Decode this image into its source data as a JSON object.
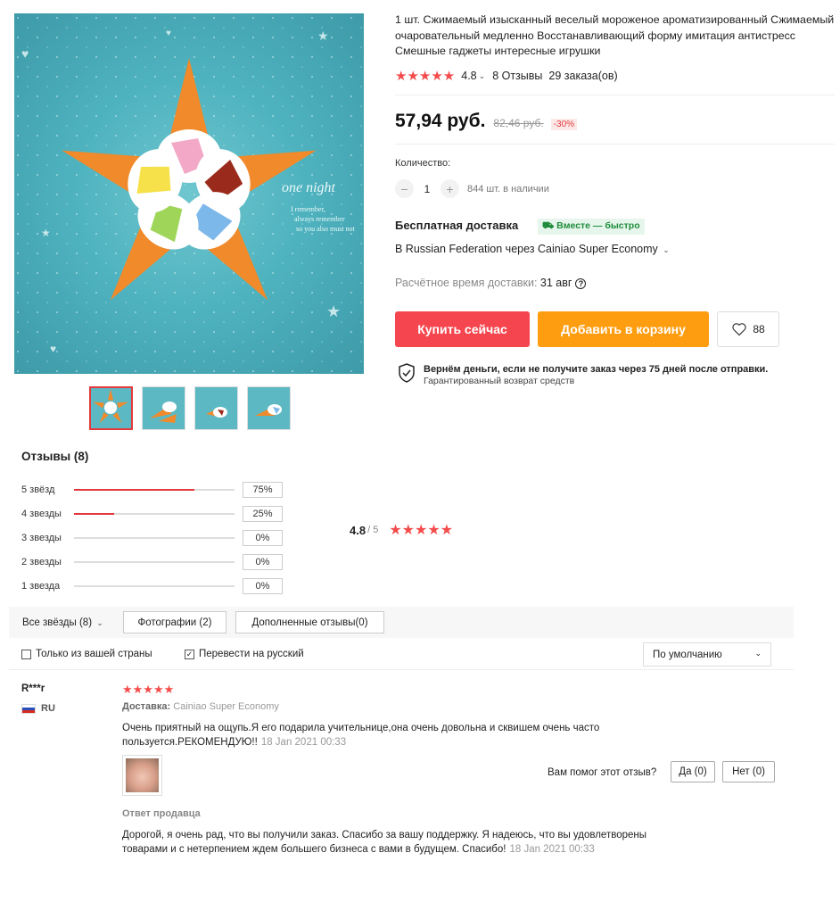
{
  "product": {
    "title": "1 шт. Сжимаемый изысканный веселый мороженое ароматизированный Сжимаемый очаровательный медленно Восстанавливающий форму имитация антистресс Смешные гаджеты интересные игрушки",
    "rating": "4.8",
    "reviews_link": "8 Отзывы",
    "orders": "29 заказа(ов)",
    "price": "57,94 руб.",
    "old_price": "82,46 руб.",
    "discount": "-30%",
    "quantity_label": "Количество:",
    "quantity_value": "1",
    "stock": "844 шт. в наличии",
    "shipping_title": "Бесплатная доставка",
    "shipping_badge": "Вместе — быстро",
    "shipping_route": "В Russian Federation через Cainiao Super Economy",
    "delivery_time_label": "Расчётное время доставки:",
    "delivery_time_value": "31 авг",
    "buy_label": "Купить сейчас",
    "cart_label": "Добавить в корзину",
    "wish_count": "88",
    "guarantee_title": "Вернём деньги, если не получите заказ через 75 дней после отправки.",
    "guarantee_sub": "Гарантированный возврат средств"
  },
  "reviews_summary": {
    "heading": "Отзывы (8)",
    "rows": [
      {
        "label": "5 звёзд",
        "pct": "75%",
        "fill": 0.75
      },
      {
        "label": "4 звезды",
        "pct": "25%",
        "fill": 0.25
      },
      {
        "label": "3 звезды",
        "pct": "0%",
        "fill": 0
      },
      {
        "label": "2 звезды",
        "pct": "0%",
        "fill": 0
      },
      {
        "label": "1 звезда",
        "pct": "0%",
        "fill": 0
      }
    ],
    "avg": "4.8",
    "avg_of": "/ 5"
  },
  "filters": {
    "all": "Все звёзды (8)",
    "photos": "Фотографии (2)",
    "additional": "Дополненные отзывы(0)",
    "only_country": "Только из вашей страны",
    "translate": "Перевести на русский",
    "sort": "По умолчанию"
  },
  "review": {
    "user": "R***r",
    "country": "RU",
    "delivery_label": "Доставка:",
    "delivery_value": "Cainiao Super Economy",
    "text": "Очень приятный на ощупь.Я его подарила учительнице,она очень довольна и сквишем очень часто пользуется.РЕКОМЕНДУЮ!!",
    "date": "18 Jan 2021 00:33",
    "helpful_q": "Вам помог этот отзыв?",
    "yes": "Да (0)",
    "no": "Нет (0)",
    "seller_head": "Ответ продавца",
    "seller_text": "Дорогой, я очень рад, что вы получили заказ. Спасибо за вашу поддержку. Я надеюсь, что вы удовлетворены товарами и с нетерпением ждем большего бизнеса с вами в будущем. Спасибо!",
    "seller_date": "18 Jan 2021 00:33"
  },
  "colors": {
    "accent_red": "#f5464f",
    "accent_orange": "#ff9d10",
    "star": "#f44c4c"
  },
  "image_text": {
    "line1": "one night",
    "line2": "I remember,",
    "line3": "always remember",
    "line4": "so you also must not"
  }
}
